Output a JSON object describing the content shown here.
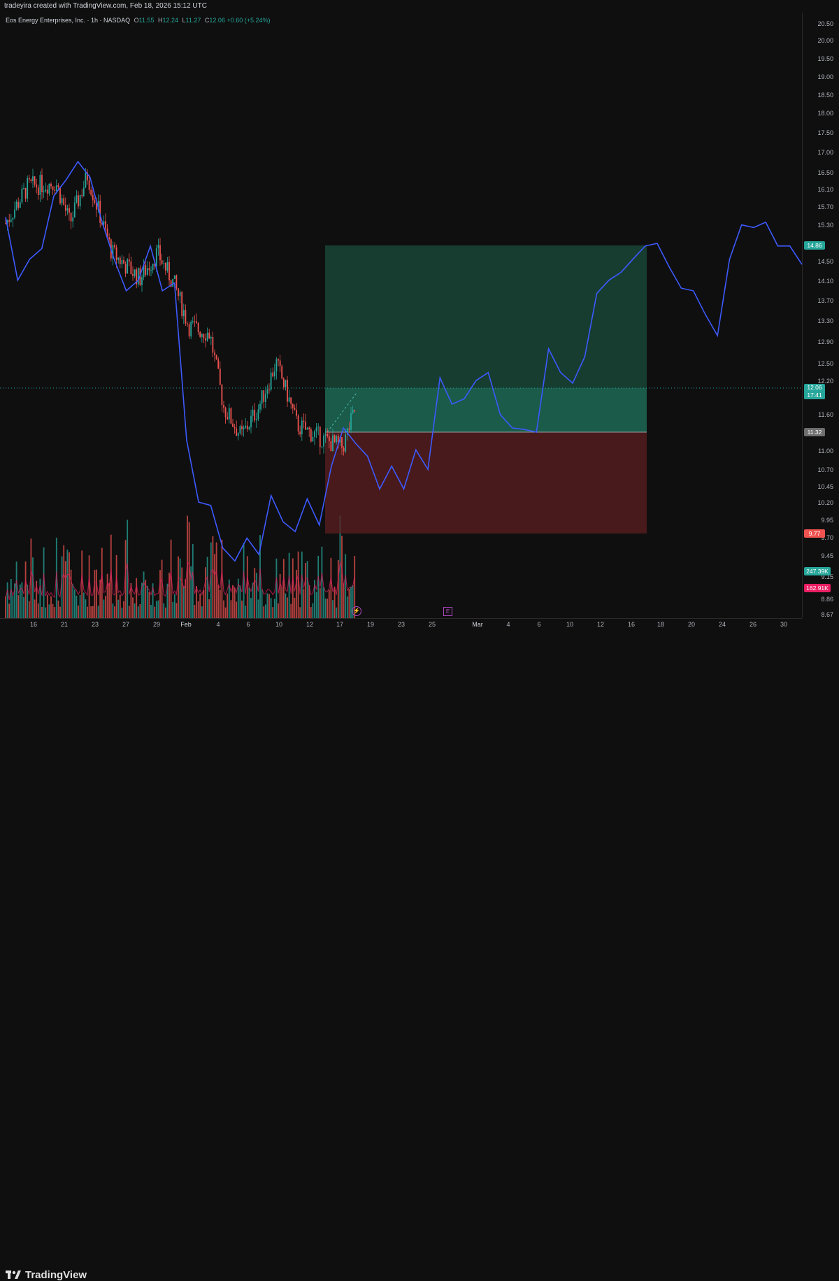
{
  "header": {
    "attribution": "tradeyira created with TradingView.com, Feb 18, 2026 15:12 UTC"
  },
  "symbol": {
    "name": "Eos Energy Enterprises, Inc. · 1h · NASDAQ",
    "open_label": "O",
    "open": "11.55",
    "high_label": "H",
    "high": "12.24",
    "low_label": "L",
    "low": "11.27",
    "close_label": "C",
    "close": "12.06",
    "change": "+0.60 (+5.24%)"
  },
  "price_axis": {
    "ticks": [
      "20.50",
      "20.00",
      "19.50",
      "19.00",
      "18.50",
      "18.00",
      "17.50",
      "17.00",
      "16.50",
      "16.10",
      "15.70",
      "15.30",
      "14.50",
      "14.10",
      "13.70",
      "13.30",
      "12.90",
      "12.50",
      "12.20",
      "11.60",
      "11.00",
      "10.70",
      "10.45",
      "10.20",
      "9.95",
      "9.70",
      "9.45",
      "9.15",
      "8.86",
      "8.67"
    ],
    "badges": {
      "target": "14.86",
      "last_price": "12.06",
      "countdown": "17:41",
      "entry": "11.32",
      "stop": "9.77",
      "volume_up": "247.39K",
      "volume_ma": "162.91K"
    }
  },
  "time_axis": {
    "labels": [
      "16",
      "21",
      "23",
      "27",
      "29",
      "Feb",
      "4",
      "6",
      "10",
      "12",
      "17",
      "19",
      "23",
      "25",
      "Mar",
      "4",
      "6",
      "10",
      "12",
      "16",
      "18",
      "20",
      "24",
      "26",
      "30"
    ]
  },
  "markers": {
    "earnings": "E"
  },
  "footer": {
    "logo_text": "TradingView"
  },
  "colors": {
    "up": "#26a69a",
    "down": "#ef5350",
    "projection_line": "#3d5afe",
    "profit_zone": "#1b4d3e",
    "loss_zone": "#5c1f22",
    "volume_ma": "#e91e63"
  },
  "chart_data": {
    "type": "line",
    "title": "Eos Energy Enterprises, Inc. · 1h · NASDAQ",
    "position": {
      "entry": 11.32,
      "target": 14.86,
      "stop": 9.77
    },
    "series": [
      {
        "name": "",
        "values": [
          15.4,
          14.2,
          14.6,
          14.8,
          15.8,
          16.1,
          16.45,
          16.15,
          15.3,
          14.6,
          14.0,
          14.2,
          14.85,
          14.0,
          14.15,
          11.2,
          10.25,
          10.2,
          9.55,
          9.35,
          9.7,
          9.45,
          10.35,
          9.95,
          9.8,
          10.3,
          9.9,
          10.8,
          11.4,
          11.15,
          10.95,
          10.45,
          10.8,
          10.45,
          11.05,
          10.75,
          12.35,
          11.85,
          11.95,
          12.3,
          12.45,
          11.65,
          11.4,
          11.37,
          11.32,
          12.9,
          12.45,
          12.25,
          12.75,
          13.95,
          14.2,
          14.35,
          14.6,
          14.85,
          14.9,
          14.45,
          14.05,
          14.0,
          13.55,
          13.15,
          14.6,
          15.25,
          15.2,
          15.3,
          14.85,
          14.85,
          14.5
        ]
      }
    ]
  }
}
